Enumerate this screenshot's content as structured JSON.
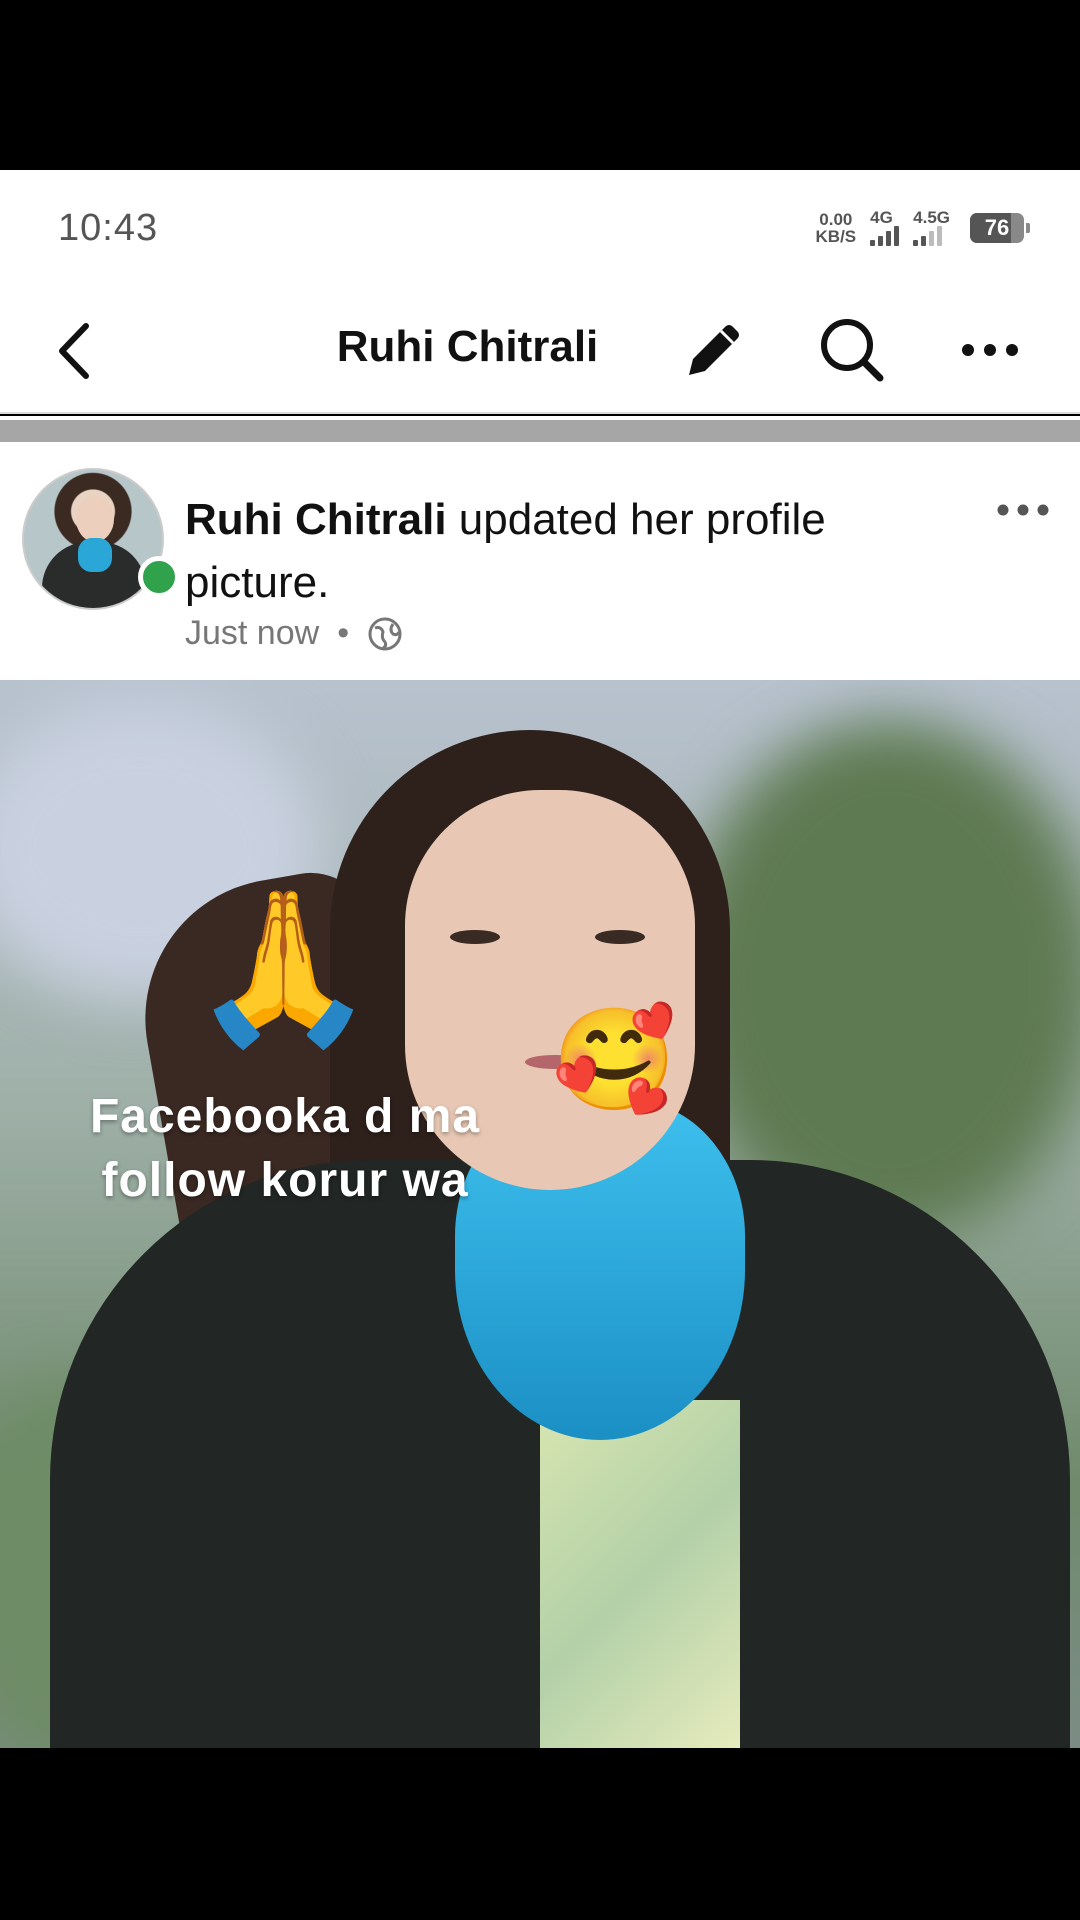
{
  "status_bar": {
    "time": "10:43",
    "net_speed_value": "0.00",
    "net_speed_unit": "KB/S",
    "signal_1_label": "4G",
    "signal_2_label": "4.5G",
    "battery_percent": "76",
    "battery_level": 0.76
  },
  "header": {
    "title": "Ruhi Chitrali",
    "icons": [
      "back-arrow-icon",
      "pencil-icon",
      "search-icon",
      "more-icon"
    ]
  },
  "post": {
    "author": "Ruhi Chitrali",
    "action_text": " updated her profile picture.",
    "time": "Just now",
    "separator": "•",
    "audience_icon": "globe-icon",
    "online_color": "#31a24c",
    "photo": {
      "caption": "Facebooka d ma follow korur wa",
      "emoji_hands": "🙏",
      "emoji_face": "🥰"
    }
  }
}
